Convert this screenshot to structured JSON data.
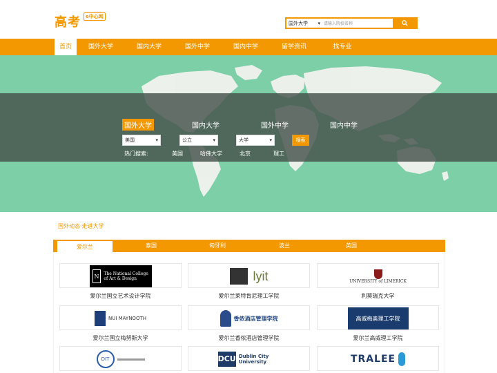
{
  "logo": {
    "main": "高考",
    "sub": "e中心网"
  },
  "search": {
    "select_value": "国外大学",
    "placeholder": "请输入院校名称",
    "button_icon": "search-icon"
  },
  "nav": {
    "items": [
      "首页",
      "国外大学",
      "国内大学",
      "国外中学",
      "国内中学",
      "留学资讯",
      "找专业"
    ],
    "active": "首页"
  },
  "banner": {
    "tabs": [
      "国外大学",
      "国内大学",
      "国外中学",
      "国内中学"
    ],
    "active_tab": "国外大学",
    "selects": [
      "美国",
      "公立",
      "大学"
    ],
    "search_button": "搜索",
    "hot_label": "热门搜索:",
    "hot_items": [
      "美国",
      "哈佛大学",
      "北京",
      "理工"
    ]
  },
  "section": {
    "title": "国外动态·走进大学",
    "tabs": [
      "爱尔兰",
      "泰国",
      "匈牙利",
      "波兰",
      "英国"
    ],
    "active_tab": "爱尔兰",
    "universities": [
      {
        "name": "爱尔兰国立艺术设计学院",
        "logo_text": "The National College of Art & Design"
      },
      {
        "name": "爱尔兰莱特肯尼理工学院",
        "logo_text": "lyit"
      },
      {
        "name": "利莫瑞克大学",
        "logo_text": "UNIVERSITY of LIMERICK"
      },
      {
        "name": "爱尔兰国立梅努斯大学",
        "logo_text": "NUI MAYNOOTH"
      },
      {
        "name": "爱尔兰香侬酒店管理学院",
        "logo_text": "香侬酒店管理学院"
      },
      {
        "name": "爱尔兰高威理工学院",
        "logo_text": "高威梅奥理工学院"
      },
      {
        "name": "",
        "logo_text": "DIT"
      },
      {
        "name": "",
        "logo_text": "Dublin City University"
      },
      {
        "name": "",
        "logo_text": "TRALEE"
      }
    ]
  },
  "colors": {
    "accent": "#f39800",
    "banner": "#7dcfa8",
    "band": "#4b5550"
  }
}
